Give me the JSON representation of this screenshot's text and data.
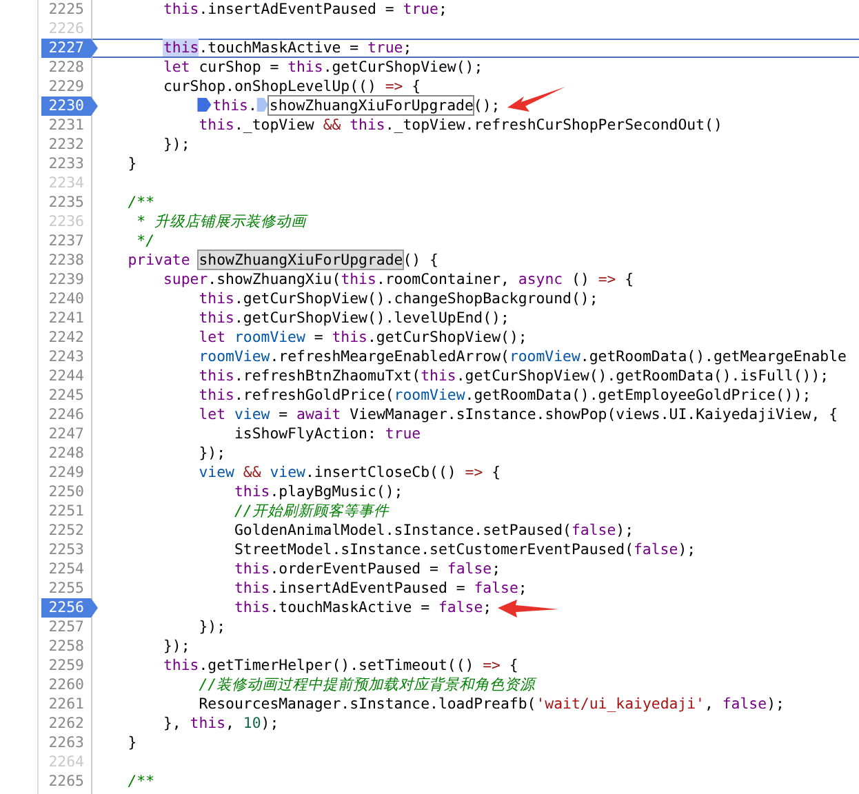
{
  "editor": {
    "lines": [
      {
        "number": "2225",
        "breakpoint": false,
        "dim": false,
        "tokens": [
          {
            "kind": "kw",
            "text": "        this"
          },
          {
            "kind": "plain",
            "text": ".insertAdEventPaused = "
          },
          {
            "kind": "kw",
            "text": "true"
          },
          {
            "kind": "plain",
            "text": ";"
          }
        ]
      },
      {
        "number": "2226",
        "breakpoint": false,
        "dim": true
      },
      {
        "number": "2227",
        "breakpoint": true,
        "dim": false,
        "current": true,
        "tokens": [
          {
            "kind": "sel",
            "text": "        this"
          },
          {
            "kind": "plain",
            "text": ".touchMaskActive = "
          },
          {
            "kind": "kw",
            "text": "true"
          },
          {
            "kind": "plain",
            "text": ";"
          }
        ]
      },
      {
        "number": "2228",
        "breakpoint": false,
        "dim": false,
        "tokens": [
          {
            "kind": "kw",
            "text": "        let"
          },
          {
            "kind": "plain",
            "text": " curShop = "
          },
          {
            "kind": "kw",
            "text": "this"
          },
          {
            "kind": "plain",
            "text": ".getCurShopView();"
          }
        ]
      },
      {
        "number": "2229",
        "breakpoint": false,
        "dim": false,
        "tokens": [
          {
            "kind": "plain",
            "text": "        curShop.onShopLevelUp(() "
          },
          {
            "kind": "op",
            "text": "=>"
          },
          {
            "kind": "plain",
            "text": " {"
          }
        ]
      },
      {
        "number": "2230",
        "breakpoint": true,
        "dim": false,
        "pointer": {
          "kind": "rising"
        },
        "tokens": [
          {
            "kind": "kw",
            "text": "            this",
            "marker": {
              "kind": "active"
            }
          },
          {
            "kind": "plain",
            "text": "."
          },
          {
            "kind": "match",
            "text": "showZhuangXiuForUpgrade",
            "marker": {
              "kind": "inactive"
            }
          },
          {
            "kind": "plain",
            "text": "();"
          }
        ]
      },
      {
        "number": "2231",
        "breakpoint": false,
        "dim": false,
        "tokens": [
          {
            "kind": "kw",
            "text": "            this"
          },
          {
            "kind": "plain",
            "text": "._topView "
          },
          {
            "kind": "op",
            "text": "&&"
          },
          {
            "kind": "kw",
            "text": " this"
          },
          {
            "kind": "plain",
            "text": "._topView.refreshCurShopPerSecondOut()"
          }
        ]
      },
      {
        "number": "2232",
        "breakpoint": false,
        "dim": false,
        "tokens": [
          {
            "kind": "plain",
            "text": "        });"
          }
        ]
      },
      {
        "number": "2233",
        "breakpoint": false,
        "dim": false,
        "tokens": [
          {
            "kind": "plain",
            "text": "    }"
          }
        ]
      },
      {
        "number": "2234",
        "breakpoint": false,
        "dim": true
      },
      {
        "number": "2235",
        "breakpoint": false,
        "dim": false,
        "tokens": [
          {
            "kind": "comment",
            "text": "    /**"
          }
        ]
      },
      {
        "number": "2236",
        "breakpoint": false,
        "dim": true,
        "tokens": [
          {
            "kind": "comment",
            "text": "     * 升级店铺展示装修动画"
          }
        ]
      },
      {
        "number": "2237",
        "breakpoint": false,
        "dim": false,
        "tokens": [
          {
            "kind": "comment",
            "text": "     */"
          }
        ]
      },
      {
        "number": "2238",
        "breakpoint": false,
        "dim": false,
        "tokens": [
          {
            "kind": "kw",
            "text": "    private "
          },
          {
            "kind": "found",
            "text": "showZhuangXiuForUpgrade"
          },
          {
            "kind": "plain",
            "text": "() {"
          }
        ]
      },
      {
        "number": "2239",
        "breakpoint": false,
        "dim": false,
        "tokens": [
          {
            "kind": "kw",
            "text": "        super"
          },
          {
            "kind": "plain",
            "text": ".showZhuangXiu("
          },
          {
            "kind": "kw",
            "text": "this"
          },
          {
            "kind": "plain",
            "text": ".roomContainer, "
          },
          {
            "kind": "kw",
            "text": "async"
          },
          {
            "kind": "plain",
            "text": " () "
          },
          {
            "kind": "op",
            "text": "=>"
          },
          {
            "kind": "plain",
            "text": " {"
          }
        ]
      },
      {
        "number": "2240",
        "breakpoint": false,
        "dim": false,
        "tokens": [
          {
            "kind": "kw",
            "text": "            this"
          },
          {
            "kind": "plain",
            "text": ".getCurShopView().changeShopBackground();"
          }
        ]
      },
      {
        "number": "2241",
        "breakpoint": false,
        "dim": false,
        "tokens": [
          {
            "kind": "kw",
            "text": "            this"
          },
          {
            "kind": "plain",
            "text": ".getCurShopView().levelUpEnd();"
          }
        ]
      },
      {
        "number": "2242",
        "breakpoint": false,
        "dim": false,
        "tokens": [
          {
            "kind": "kw",
            "text": "            let "
          },
          {
            "kind": "var",
            "text": "roomView"
          },
          {
            "kind": "plain",
            "text": " = "
          },
          {
            "kind": "kw",
            "text": "this"
          },
          {
            "kind": "plain",
            "text": ".getCurShopView();"
          }
        ]
      },
      {
        "number": "2243",
        "breakpoint": false,
        "dim": false,
        "tokens": [
          {
            "kind": "var",
            "text": "            roomView"
          },
          {
            "kind": "plain",
            "text": ".refreshMeargeEnabledArrow("
          },
          {
            "kind": "var",
            "text": "roomView"
          },
          {
            "kind": "plain",
            "text": ".getRoomData().getMeargeEnable"
          }
        ]
      },
      {
        "number": "2244",
        "breakpoint": false,
        "dim": false,
        "tokens": [
          {
            "kind": "kw",
            "text": "            this"
          },
          {
            "kind": "plain",
            "text": ".refreshBtnZhaomuTxt("
          },
          {
            "kind": "kw",
            "text": "this"
          },
          {
            "kind": "plain",
            "text": ".getCurShopView().getRoomData().isFull());"
          }
        ]
      },
      {
        "number": "2245",
        "breakpoint": false,
        "dim": false,
        "tokens": [
          {
            "kind": "kw",
            "text": "            this"
          },
          {
            "kind": "plain",
            "text": ".refreshGoldPrice("
          },
          {
            "kind": "var",
            "text": "roomView"
          },
          {
            "kind": "plain",
            "text": ".getRoomData().getEmployeeGoldPrice());"
          }
        ]
      },
      {
        "number": "2246",
        "breakpoint": false,
        "dim": false,
        "tokens": [
          {
            "kind": "kw",
            "text": "            let "
          },
          {
            "kind": "var",
            "text": "view"
          },
          {
            "kind": "plain",
            "text": " = "
          },
          {
            "kind": "kw",
            "text": "await"
          },
          {
            "kind": "plain",
            "text": " ViewManager.sInstance.showPop(views.UI.KaiyedajiView, {"
          }
        ]
      },
      {
        "number": "2247",
        "breakpoint": false,
        "dim": false,
        "tokens": [
          {
            "kind": "plain",
            "text": "                isShowFlyAction: "
          },
          {
            "kind": "kw",
            "text": "true"
          }
        ]
      },
      {
        "number": "2248",
        "breakpoint": false,
        "dim": false,
        "tokens": [
          {
            "kind": "plain",
            "text": "            });"
          }
        ]
      },
      {
        "number": "2249",
        "breakpoint": false,
        "dim": false,
        "tokens": [
          {
            "kind": "var",
            "text": "            view"
          },
          {
            "kind": "op",
            "text": " && "
          },
          {
            "kind": "var",
            "text": "view"
          },
          {
            "kind": "plain",
            "text": ".insertCloseCb(() "
          },
          {
            "kind": "op",
            "text": "=>"
          },
          {
            "kind": "plain",
            "text": " {"
          }
        ]
      },
      {
        "number": "2250",
        "breakpoint": false,
        "dim": false,
        "tokens": [
          {
            "kind": "kw",
            "text": "                this"
          },
          {
            "kind": "plain",
            "text": ".playBgMusic();"
          }
        ]
      },
      {
        "number": "2251",
        "breakpoint": false,
        "dim": false,
        "tokens": [
          {
            "kind": "comment",
            "text": "                //开始刷新顾客等事件"
          }
        ]
      },
      {
        "number": "2252",
        "breakpoint": false,
        "dim": false,
        "tokens": [
          {
            "kind": "plain",
            "text": "                GoldenAnimalModel.sInstance.setPaused("
          },
          {
            "kind": "kw",
            "text": "false"
          },
          {
            "kind": "plain",
            "text": ");"
          }
        ]
      },
      {
        "number": "2253",
        "breakpoint": false,
        "dim": false,
        "tokens": [
          {
            "kind": "plain",
            "text": "                StreetModel.sInstance.setCustomerEventPaused("
          },
          {
            "kind": "kw",
            "text": "false"
          },
          {
            "kind": "plain",
            "text": ");"
          }
        ]
      },
      {
        "number": "2254",
        "breakpoint": false,
        "dim": false,
        "tokens": [
          {
            "kind": "kw",
            "text": "                this"
          },
          {
            "kind": "plain",
            "text": ".orderEventPaused = "
          },
          {
            "kind": "kw",
            "text": "false"
          },
          {
            "kind": "plain",
            "text": ";"
          }
        ]
      },
      {
        "number": "2255",
        "breakpoint": false,
        "dim": false,
        "tokens": [
          {
            "kind": "kw",
            "text": "                this"
          },
          {
            "kind": "plain",
            "text": ".insertAdEventPaused = "
          },
          {
            "kind": "kw",
            "text": "false"
          },
          {
            "kind": "plain",
            "text": ";"
          }
        ]
      },
      {
        "number": "2256",
        "breakpoint": true,
        "dim": false,
        "pointer": {
          "kind": "flat"
        },
        "tokens": [
          {
            "kind": "kw",
            "text": "                this"
          },
          {
            "kind": "plain",
            "text": ".touchMaskActive = "
          },
          {
            "kind": "kw",
            "text": "false"
          },
          {
            "kind": "plain",
            "text": ";"
          }
        ]
      },
      {
        "number": "2257",
        "breakpoint": false,
        "dim": false,
        "tokens": [
          {
            "kind": "plain",
            "text": "            });"
          }
        ]
      },
      {
        "number": "2258",
        "breakpoint": false,
        "dim": false,
        "tokens": [
          {
            "kind": "plain",
            "text": "        });"
          }
        ]
      },
      {
        "number": "2259",
        "breakpoint": false,
        "dim": false,
        "tokens": [
          {
            "kind": "kw",
            "text": "        this"
          },
          {
            "kind": "plain",
            "text": ".getTimerHelper().setTimeout(() "
          },
          {
            "kind": "op",
            "text": "=>"
          },
          {
            "kind": "plain",
            "text": " {"
          }
        ]
      },
      {
        "number": "2260",
        "breakpoint": false,
        "dim": false,
        "tokens": [
          {
            "kind": "comment",
            "text": "            //装修动画过程中提前预加载对应背景和角色资源"
          }
        ]
      },
      {
        "number": "2261",
        "breakpoint": false,
        "dim": false,
        "tokens": [
          {
            "kind": "plain",
            "text": "            ResourcesManager.sInstance.loadPreafb("
          },
          {
            "kind": "str",
            "text": "'wait/ui_kaiyedaji'"
          },
          {
            "kind": "plain",
            "text": ", "
          },
          {
            "kind": "kw",
            "text": "false"
          },
          {
            "kind": "plain",
            "text": ");"
          }
        ]
      },
      {
        "number": "2262",
        "breakpoint": false,
        "dim": false,
        "tokens": [
          {
            "kind": "plain",
            "text": "        }, "
          },
          {
            "kind": "kw",
            "text": "this"
          },
          {
            "kind": "plain",
            "text": ", "
          },
          {
            "kind": "num",
            "text": "10"
          },
          {
            "kind": "plain",
            "text": ");"
          }
        ]
      },
      {
        "number": "2263",
        "breakpoint": false,
        "dim": false,
        "tokens": [
          {
            "kind": "plain",
            "text": "    }"
          }
        ]
      },
      {
        "number": "2264",
        "breakpoint": false,
        "dim": true
      },
      {
        "number": "2265",
        "breakpoint": false,
        "dim": false,
        "tokens": [
          {
            "kind": "comment",
            "text": "    /**"
          }
        ]
      }
    ]
  }
}
